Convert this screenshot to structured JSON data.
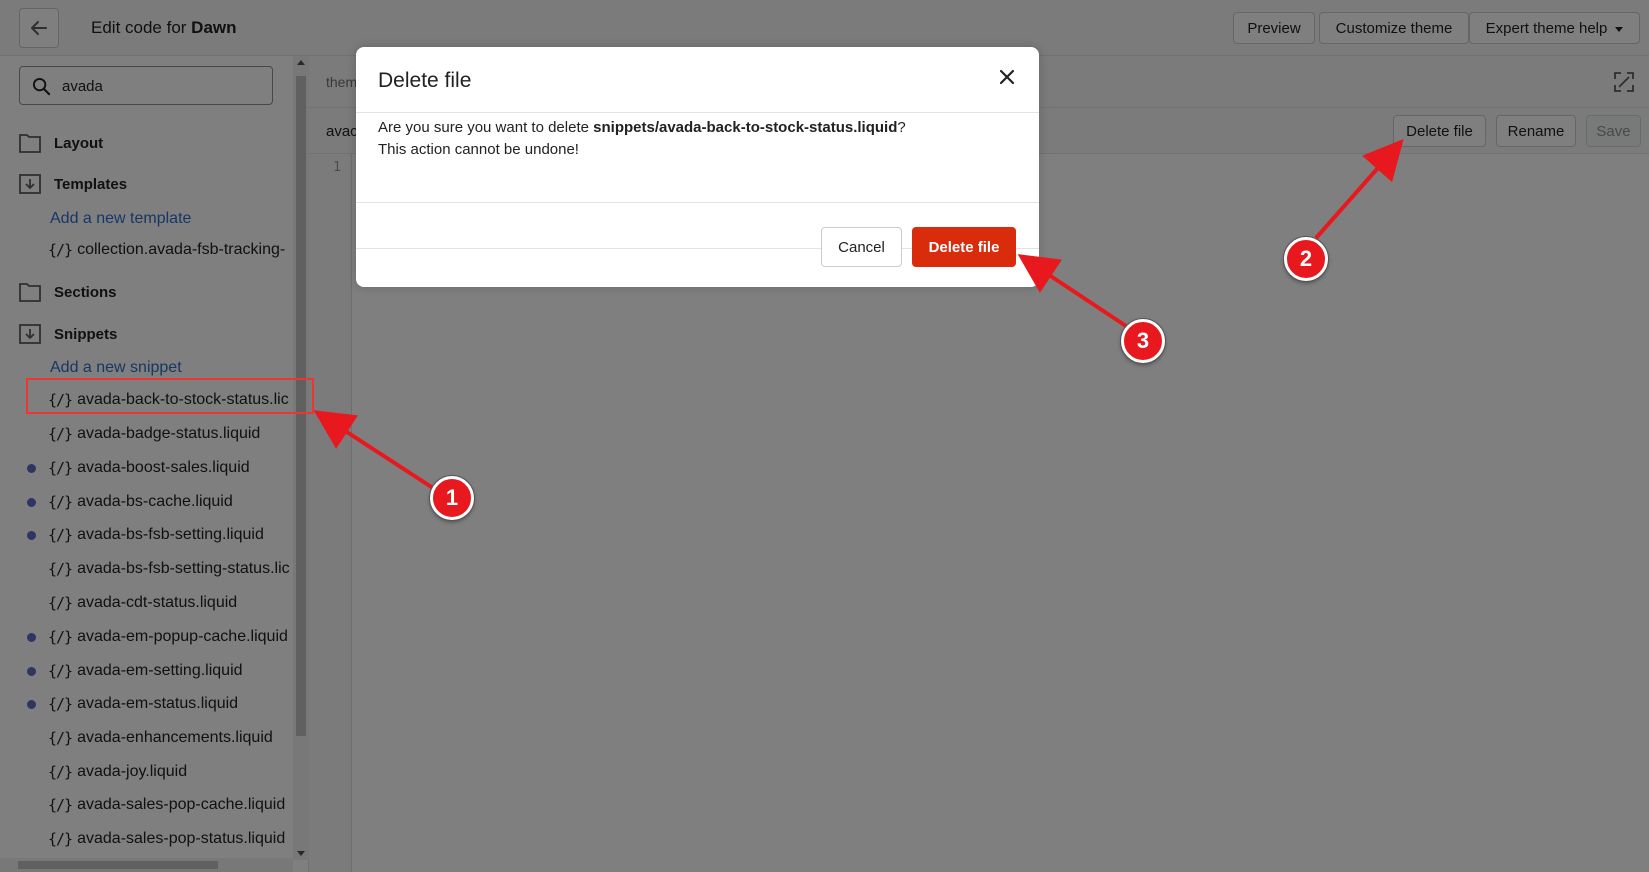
{
  "header": {
    "title_prefix": "Edit code for ",
    "title_theme": "Dawn",
    "preview_label": "Preview",
    "customize_label": "Customize theme",
    "help_label": "Expert theme help"
  },
  "sidebar": {
    "search_value": "avada",
    "folders": {
      "layout": "Layout",
      "templates": "Templates",
      "sections": "Sections",
      "snippets": "Snippets"
    },
    "add_template": "Add a new template",
    "template_files": [
      "collection.avada-fsb-tracking-"
    ],
    "add_snippet": "Add a new snippet",
    "snippet_files": [
      "avada-back-to-stock-status.lic",
      "avada-badge-status.liquid",
      "avada-boost-sales.liquid",
      "avada-bs-cache.liquid",
      "avada-bs-fsb-setting.liquid",
      "avada-bs-fsb-setting-status.lic",
      "avada-cdt-status.liquid",
      "avada-em-popup-cache.liquid",
      "avada-em-setting.liquid",
      "avada-em-status.liquid",
      "avada-enhancements.liquid",
      "avada-joy.liquid",
      "avada-sales-pop-cache.liquid",
      "avada-sales-pop-status.liquid"
    ],
    "code_glyph": "{/}"
  },
  "editor": {
    "tab_text": "them",
    "file_name": "avac",
    "delete_label": "Delete file",
    "rename_label": "Rename",
    "save_label": "Save",
    "line_number": "1"
  },
  "modal": {
    "title": "Delete file",
    "body_prefix": "Are you sure you want to delete ",
    "body_file": "snippets/avada-back-to-stock-status.liquid",
    "body_suffix": "?",
    "body_line2": "This action cannot be undone!",
    "cancel_label": "Cancel",
    "confirm_label": "Delete file"
  },
  "annotations": {
    "step1": "1",
    "step2": "2",
    "step3": "3"
  },
  "colors": {
    "danger": "#d82c0d",
    "annotation": "#e8181f",
    "link": "#2c6ecb"
  }
}
